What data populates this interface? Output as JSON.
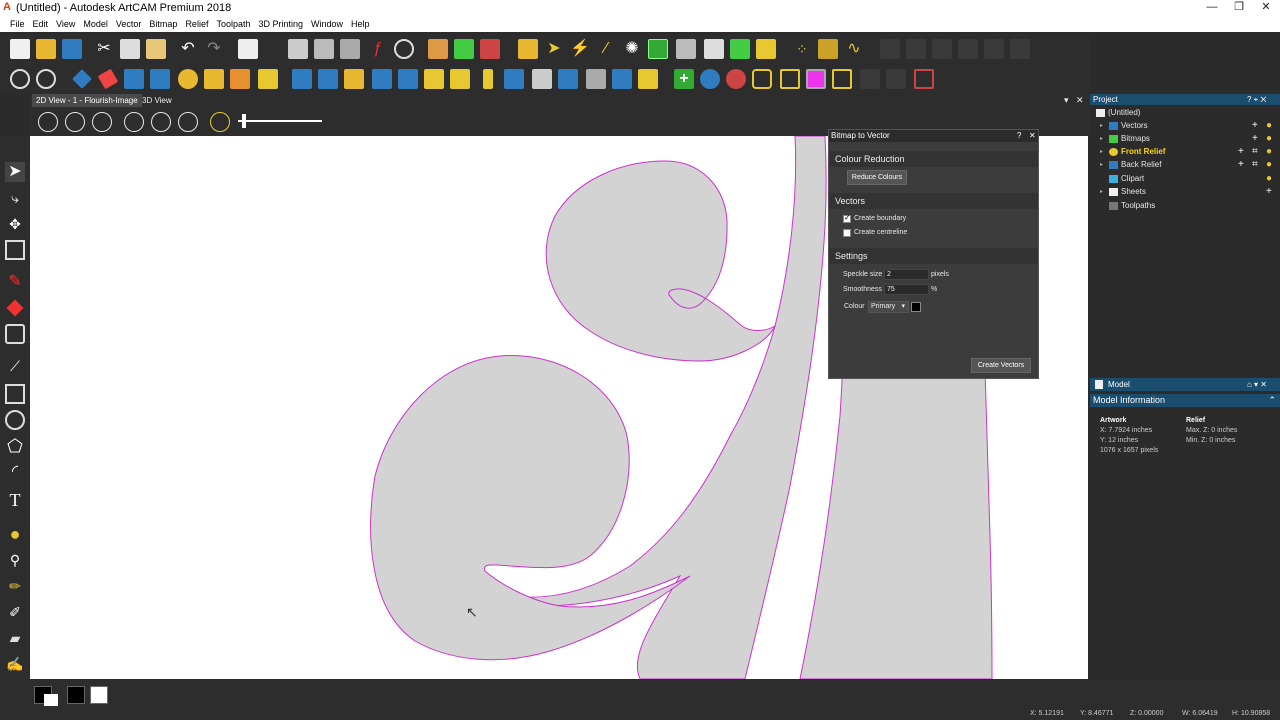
{
  "window": {
    "title": "(Untitled) - Autodesk ArtCAM Premium 2018",
    "minimize": "—",
    "maximize": "❐",
    "close": "✕"
  },
  "menu": [
    "File",
    "Edit",
    "View",
    "Model",
    "Vector",
    "Bitmap",
    "Relief",
    "Toolpath",
    "3D Printing",
    "Window",
    "Help"
  ],
  "view_tabs": {
    "tab1": "2D View - 1 - Flourish-Image",
    "tab2": "3D View",
    "pin": "▾",
    "close": "✕"
  },
  "dialog": {
    "title": "Bitmap to Vector",
    "help": "?",
    "close": "✕",
    "colour_reduction": {
      "heading": "Colour Reduction",
      "button": "Reduce Colours"
    },
    "vectors": {
      "heading": "Vectors",
      "create_boundary": {
        "label": "Create boundary",
        "checked": true
      },
      "create_centreline": {
        "label": "Create centreline",
        "checked": false
      }
    },
    "settings": {
      "heading": "Settings",
      "speckle_label": "Speckle size",
      "speckle_value": "2",
      "speckle_unit": "pixels",
      "smoothness_label": "Smoothness",
      "smoothness_value": "75",
      "smoothness_unit": "%",
      "colour_label": "Colour",
      "colour_value": "Primary",
      "colour_swatch": "#000000"
    },
    "create_button": "Create Vectors"
  },
  "project": {
    "title": "Project",
    "controls": "? ⌖ ✕",
    "items": [
      {
        "label": "(Untitled)",
        "expand": ""
      },
      {
        "label": "Vectors",
        "expand": "▸"
      },
      {
        "label": "Bitmaps",
        "expand": "▸"
      },
      {
        "label": "Front Relief",
        "expand": "▸"
      },
      {
        "label": "Back Relief",
        "expand": "▸"
      },
      {
        "label": "Clipart",
        "expand": ""
      },
      {
        "label": "Sheets",
        "expand": "▸"
      },
      {
        "label": "Toolpaths",
        "expand": ""
      }
    ]
  },
  "model": {
    "panel_title": "Model",
    "controls": "⌂ ▾ ✕",
    "info_title": "Model Information",
    "artwork": {
      "heading": "Artwork",
      "x": "X: 7.7924 inches",
      "y": "Y: 12 inches",
      "px": "1076 x 1657 pixels"
    },
    "relief": {
      "heading": "Relief",
      "max": "Max. Z: 0 inches",
      "min": "Min. Z: 0 inches"
    }
  },
  "status": {
    "x": "X: 5.12191",
    "y": "Y: 8.46771",
    "z": "Z: 0.00000",
    "w": "W: 6.06419",
    "h": "H: 10.90858"
  },
  "colors": {
    "accent": "#1a4d6e",
    "vector_outline": "#cc33cc",
    "fill": "#d3d3d3"
  }
}
